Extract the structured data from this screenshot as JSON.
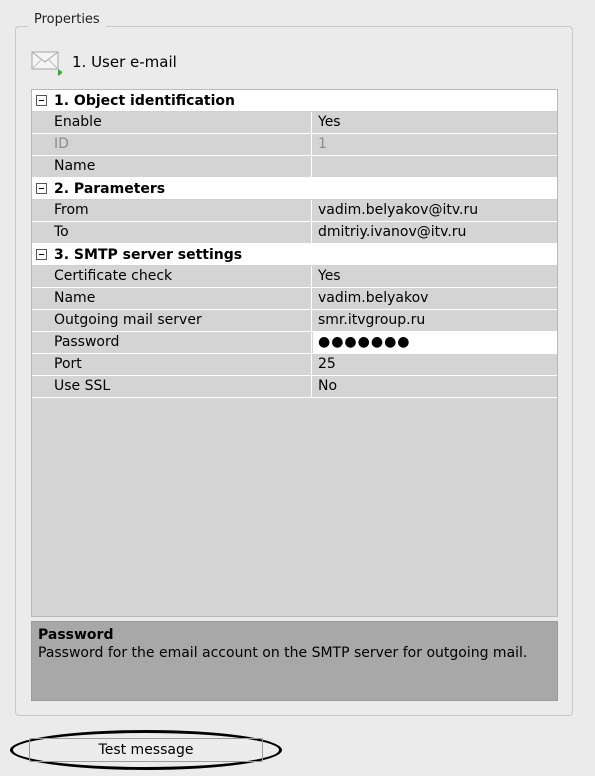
{
  "panel": {
    "title": "Properties"
  },
  "object": {
    "title": "1. User e-mail",
    "icon": "envelope-icon"
  },
  "grid": {
    "categories": [
      {
        "label": "1. Object identification",
        "props": [
          {
            "name": "Enable",
            "value": "Yes"
          },
          {
            "name": "ID",
            "value": "1"
          },
          {
            "name": "Name",
            "value": ""
          }
        ]
      },
      {
        "label": "2. Parameters",
        "props": [
          {
            "name": "From",
            "value": "vadim.belyakov@itv.ru"
          },
          {
            "name": "To",
            "value": "dmitriy.ivanov@itv.ru"
          }
        ]
      },
      {
        "label": "3. SMTP server settings",
        "props": [
          {
            "name": "Certificate check",
            "value": "Yes"
          },
          {
            "name": "Name",
            "value": "vadim.belyakov"
          },
          {
            "name": "Outgoing mail server",
            "value": "smr.itvgroup.ru"
          },
          {
            "name": "Password",
            "value": "●●●●●●●"
          },
          {
            "name": "Port",
            "value": "25"
          },
          {
            "name": "Use SSL",
            "value": "No"
          }
        ]
      }
    ]
  },
  "description": {
    "title": "Password",
    "text": "Password for the email account on the SMTP server for outgoing mail."
  },
  "buttons": {
    "test_message": "Test message"
  }
}
